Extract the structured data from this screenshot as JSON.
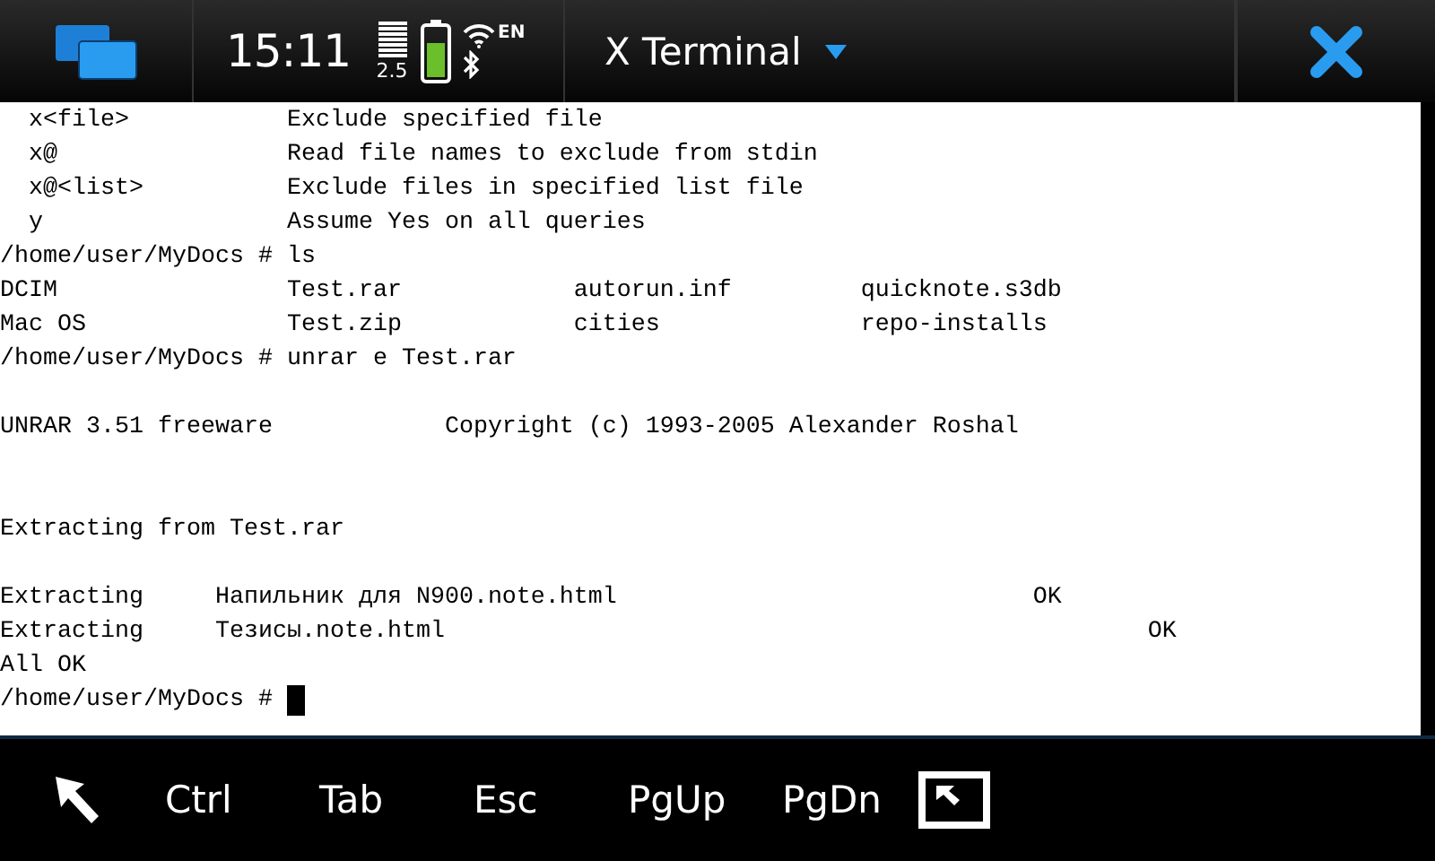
{
  "status_bar": {
    "time": "15:11",
    "network": "2.5",
    "language": "EN",
    "title": "X Terminal"
  },
  "terminal": {
    "lines": [
      {
        "kind": "text",
        "text": "  x<file>           Exclude specified file"
      },
      {
        "kind": "text",
        "text": "  x@                Read file names to exclude from stdin"
      },
      {
        "kind": "text",
        "text": "  x@<list>          Exclude files in specified list file"
      },
      {
        "kind": "text",
        "text": "  y                 Assume Yes on all queries"
      },
      {
        "kind": "text",
        "text": "/home/user/MyDocs # ls"
      },
      {
        "kind": "text",
        "text": "DCIM                Test.rar            autorun.inf         quicknote.s3db"
      },
      {
        "kind": "text",
        "text": "Mac OS              Test.zip            cities              repo-installs"
      },
      {
        "kind": "text",
        "text": "/home/user/MyDocs # unrar e Test.rar"
      },
      {
        "kind": "blank"
      },
      {
        "kind": "text",
        "text": "UNRAR 3.51 freeware            Copyright (c) 1993-2005 Alexander Roshal"
      },
      {
        "kind": "blank"
      },
      {
        "kind": "blank"
      },
      {
        "kind": "text",
        "text": "Extracting from Test.rar"
      },
      {
        "kind": "blank"
      },
      {
        "kind": "text",
        "text": "Extracting     Напильник для N900.note.html                             OK"
      },
      {
        "kind": "text",
        "text": "Extracting     Тезисы.note.html                                                 OK"
      },
      {
        "kind": "text",
        "text": "All OK"
      },
      {
        "kind": "prompt",
        "text": "/home/user/MyDocs # "
      }
    ]
  },
  "toolbar": {
    "keys": [
      "Ctrl",
      "Tab",
      "Esc",
      "PgUp",
      "PgDn"
    ]
  }
}
